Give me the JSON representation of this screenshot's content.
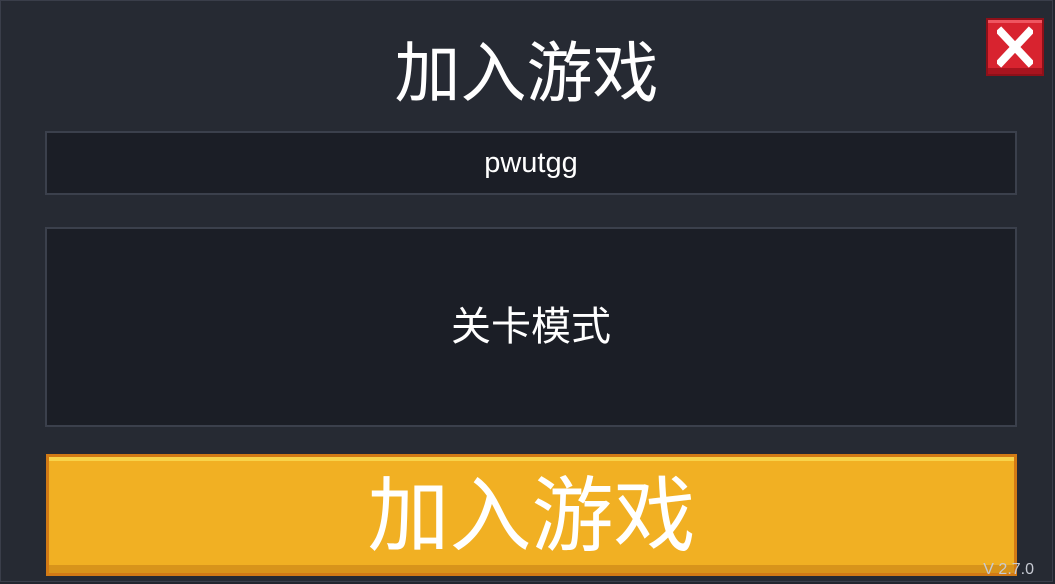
{
  "dialog": {
    "title": "加入游戏",
    "room_code": "pwutgg",
    "mode_label": "关卡模式",
    "join_button_label": "加入游戏",
    "close_icon": "close-icon",
    "version": "V 2.7.0"
  },
  "colors": {
    "background": "#262a33",
    "panel": "#1b1e26",
    "close_red": "#d8232f",
    "join_yellow": "#f1b023",
    "text": "#ffffff"
  }
}
